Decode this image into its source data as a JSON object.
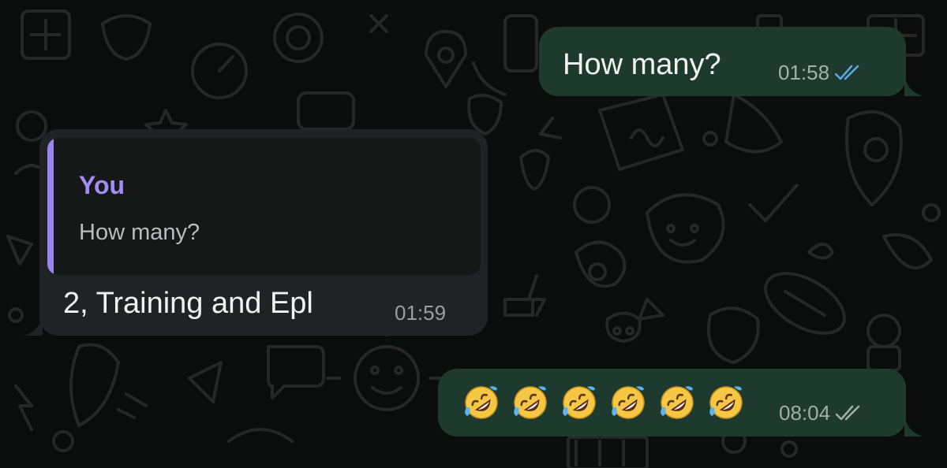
{
  "messages": [
    {
      "direction": "outgoing",
      "text": "How many?",
      "time": "01:58",
      "status": "read",
      "status_icon": "double-check-icon",
      "status_color": "#5ba7e6",
      "bubble_color": "#1e3a2f"
    },
    {
      "direction": "incoming",
      "reply_to": {
        "author": "You",
        "text": "How many?"
      },
      "text": "2, Training and Epl",
      "time": "01:59",
      "bubble_color": "#202223",
      "accent_color": "#9b84f0"
    },
    {
      "direction": "outgoing",
      "emoji": "rolling-on-the-floor-laughing",
      "emoji_count": 6,
      "time": "08:04",
      "status": "delivered",
      "status_icon": "double-check-icon",
      "status_color": "#a3ada8",
      "bubble_color": "#1e3a2f"
    }
  ]
}
